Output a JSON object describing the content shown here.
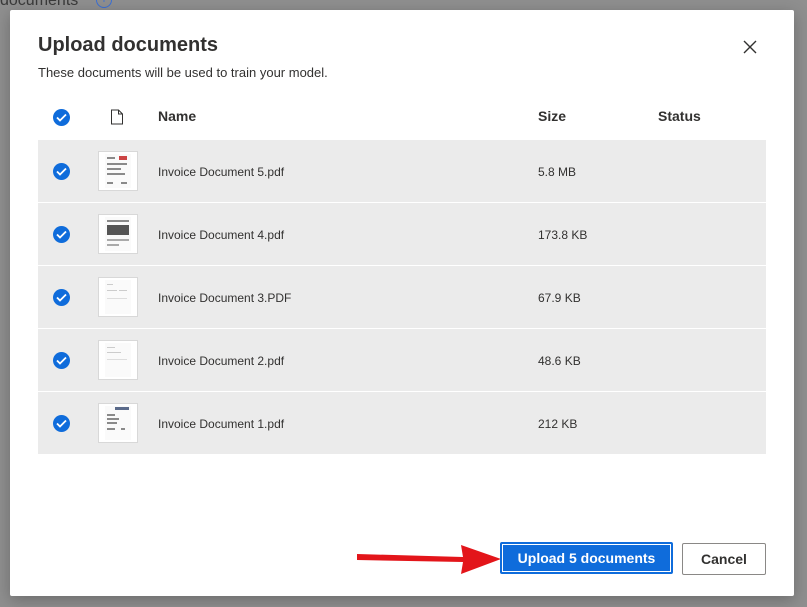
{
  "backdrop": {
    "title": "documents",
    "info_icon": "info-icon"
  },
  "dialog": {
    "title": "Upload documents",
    "subtitle": "These documents will be used to train your model.",
    "close_icon": "close-icon"
  },
  "table": {
    "columns": {
      "select_all_icon": "checkmark-circle-icon",
      "type_icon": "file-icon",
      "name": "Name",
      "size": "Size",
      "status": "Status"
    },
    "rows": [
      {
        "name": "Invoice Document 5.pdf",
        "size": "5.8 MB",
        "status": ""
      },
      {
        "name": "Invoice Document 4.pdf",
        "size": "173.8 KB",
        "status": ""
      },
      {
        "name": "Invoice Document 3.PDF",
        "size": "67.9 KB",
        "status": ""
      },
      {
        "name": "Invoice Document 2.pdf",
        "size": "48.6 KB",
        "status": ""
      },
      {
        "name": "Invoice Document 1.pdf",
        "size": "212 KB",
        "status": ""
      }
    ]
  },
  "actions": {
    "upload_label": "Upload 5 documents",
    "cancel_label": "Cancel"
  },
  "colors": {
    "accent": "#0f6cdb",
    "annotation_arrow": "#e3151a",
    "row_bg": "#ebebeb"
  }
}
